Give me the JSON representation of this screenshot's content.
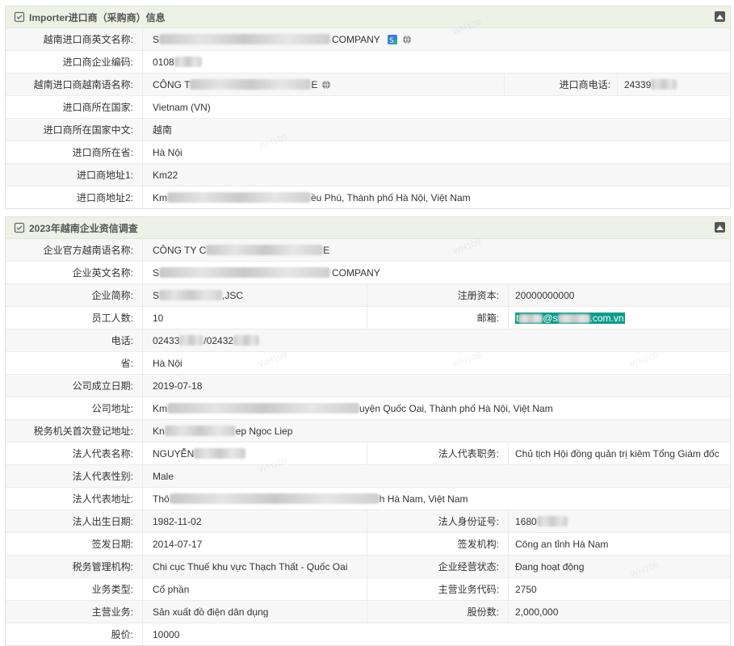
{
  "importer": {
    "title": "Importer进口商（采购商）信息",
    "rows": [
      {
        "label": "越南进口商英文名称:",
        "pre": "S",
        "post": "COMPANY"
      },
      {
        "label": "进口商企业编码:",
        "pre": "0108",
        "post": ""
      },
      {
        "label": "越南进口商越南语名称:",
        "pre": "CÔNG T",
        "post": "E",
        "phone_label": "进口商电话:",
        "phone_pre": "24339"
      },
      {
        "label": "进口商所在国家:",
        "value": "Vietnam (VN)"
      },
      {
        "label": "进口商所在国家中文:",
        "value": "越南"
      },
      {
        "label": "进口商所在省:",
        "value": "Hà Nội"
      },
      {
        "label": "进口商地址1:",
        "value": "Km22"
      },
      {
        "label": "进口商地址2:",
        "pre": "Km",
        "post": "ều Phú, Thành phố Hà Nội, Việt Nam"
      }
    ]
  },
  "survey": {
    "title": "2023年越南企业资信调查",
    "vn_name": {
      "label": "企业官方越南语名称:",
      "pre": "CÔNG TY C",
      "post": "E"
    },
    "en_name": {
      "label": "企业英文名称:",
      "pre": "S",
      "post": "COMPANY"
    },
    "abbr": {
      "label": "企业简称:",
      "pre": "S",
      "post": ",JSC",
      "right_label": "注册资本:",
      "right_value": "20000000000"
    },
    "staff": {
      "label": "员工人数:",
      "value": "10",
      "right_label": "邮箱:",
      "email_pre": "t",
      "email_mid": "@s",
      "email_post": ".com.vn"
    },
    "phone": {
      "label": "电话:",
      "pre": "02433",
      "mid": "/02432"
    },
    "province": {
      "label": "省:",
      "value": "Hà Nội"
    },
    "founded": {
      "label": "公司成立日期:",
      "value": "2019-07-18"
    },
    "address": {
      "label": "公司地址:",
      "pre": "Km",
      "post": "uyện Quốc Oai, Thành phố Hà Nội, Việt Nam"
    },
    "tax_addr": {
      "label": "税务机关首次登记地址:",
      "pre": "Kn",
      "post": "ep Ngoc Liep"
    },
    "rep_name": {
      "label": "法人代表名称:",
      "pre": "NGUYỄN",
      "right_label": "法人代表职务:",
      "right_value": "Chủ tịch Hội đồng quản trị kiêm Tổng Giám đốc"
    },
    "rep_gender": {
      "label": "法人代表性别:",
      "value": "Male"
    },
    "rep_addr": {
      "label": "法人代表地址:",
      "pre": "Thô",
      "post": "h Hà Nam, Việt Nam"
    },
    "rep_birth": {
      "label": "法人出生日期:",
      "value": "1982-11-02",
      "right_label": "法人身份证号:",
      "right_pre": "1680"
    },
    "issue": {
      "label": "签发日期:",
      "value": "2014-07-17",
      "right_label": "签发机构:",
      "right_value": "Công an tỉnh Hà Nam"
    },
    "tax_office": {
      "label": "税务管理机构:",
      "value": "Chi cục Thuế khu vực Thạch Thất - Quốc Oai",
      "right_label": "企业经营状态:",
      "right_value": "Đang hoạt động"
    },
    "biz_type": {
      "label": "业务类型:",
      "value": "Cổ phần",
      "right_label": "主营业务代码:",
      "right_value": "2750"
    },
    "main_biz": {
      "label": "主营业务:",
      "value": "Sản xuất đồ điện dân dụng",
      "right_label": "股份数:",
      "right_value": "2,000,000"
    },
    "share_price": {
      "label": "股价:",
      "value": "10000"
    }
  },
  "watermark": "WH109",
  "colors": {
    "header_bg": "#eef2e6",
    "email_highlight": "#0c9c8a"
  },
  "icons": [
    "checklist-icon",
    "collapse-icon",
    "globe-icon",
    "translate-icon"
  ]
}
